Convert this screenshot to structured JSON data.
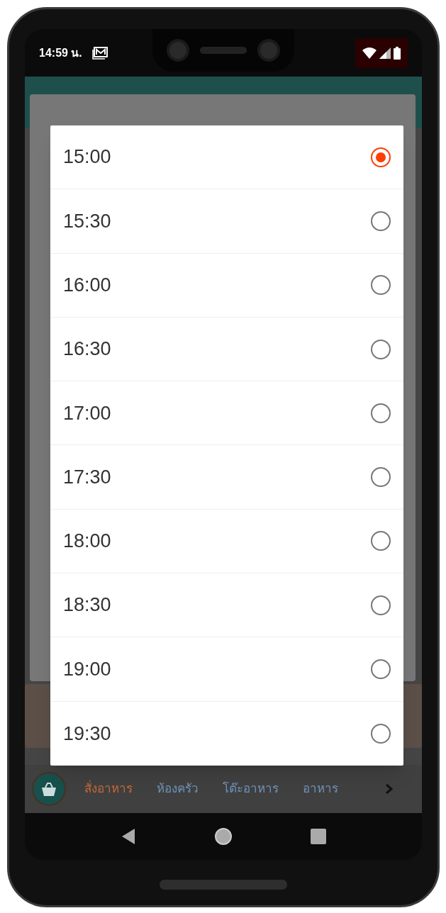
{
  "status_bar": {
    "time": "14:59 น."
  },
  "time_options": [
    {
      "label": "15:00",
      "selected": true
    },
    {
      "label": "15:30",
      "selected": false
    },
    {
      "label": "16:00",
      "selected": false
    },
    {
      "label": "16:30",
      "selected": false
    },
    {
      "label": "17:00",
      "selected": false
    },
    {
      "label": "17:30",
      "selected": false
    },
    {
      "label": "18:00",
      "selected": false
    },
    {
      "label": "18:30",
      "selected": false
    },
    {
      "label": "19:00",
      "selected": false
    },
    {
      "label": "19:30",
      "selected": false
    }
  ],
  "bottom_nav": [
    {
      "label": "สั่งอาหาร",
      "selected": true
    },
    {
      "label": "ห้องครัว",
      "selected": false
    },
    {
      "label": "โต๊ะอาหาร",
      "selected": false
    },
    {
      "label": "อาหาร",
      "selected": false
    }
  ]
}
